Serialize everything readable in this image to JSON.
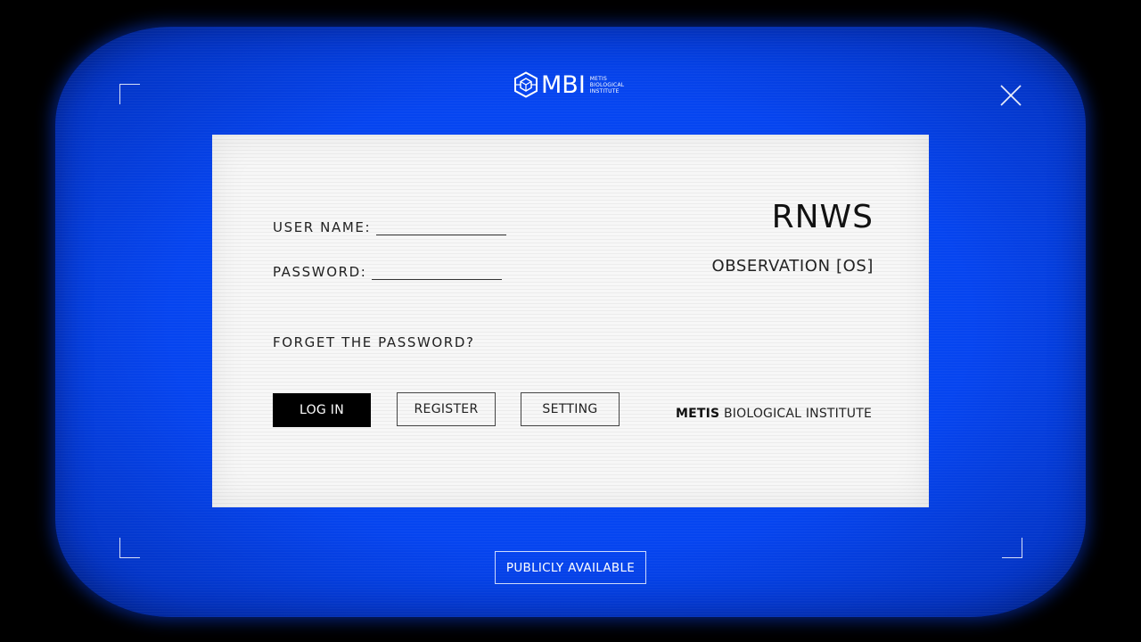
{
  "logo": {
    "mark": "MBI",
    "sub_lines": [
      "METIS",
      "BIOLOGICAL",
      "INSTITUTE"
    ],
    "icon": "hexagon-cube-icon"
  },
  "form": {
    "username_label": "USER NAME:",
    "password_label": "PASSWORD:",
    "forgot_link": "FORGET THE PASSWORD?"
  },
  "header": {
    "title": "RNWS",
    "subtitle": "OBSERVATION [OS]"
  },
  "buttons": {
    "login": "LOG IN",
    "register": "REGISTER",
    "setting": "SETTING"
  },
  "org": {
    "bold": "METIS",
    "rest": " BIOLOGICAL INSTITUTE"
  },
  "footer": {
    "public_label": "PUBLICLY AVAILABLE"
  },
  "icons": {
    "close": "close-icon"
  },
  "colors": {
    "screen": "#0645f0",
    "panel": "#f2f2f2",
    "primary_button": "#000000"
  }
}
